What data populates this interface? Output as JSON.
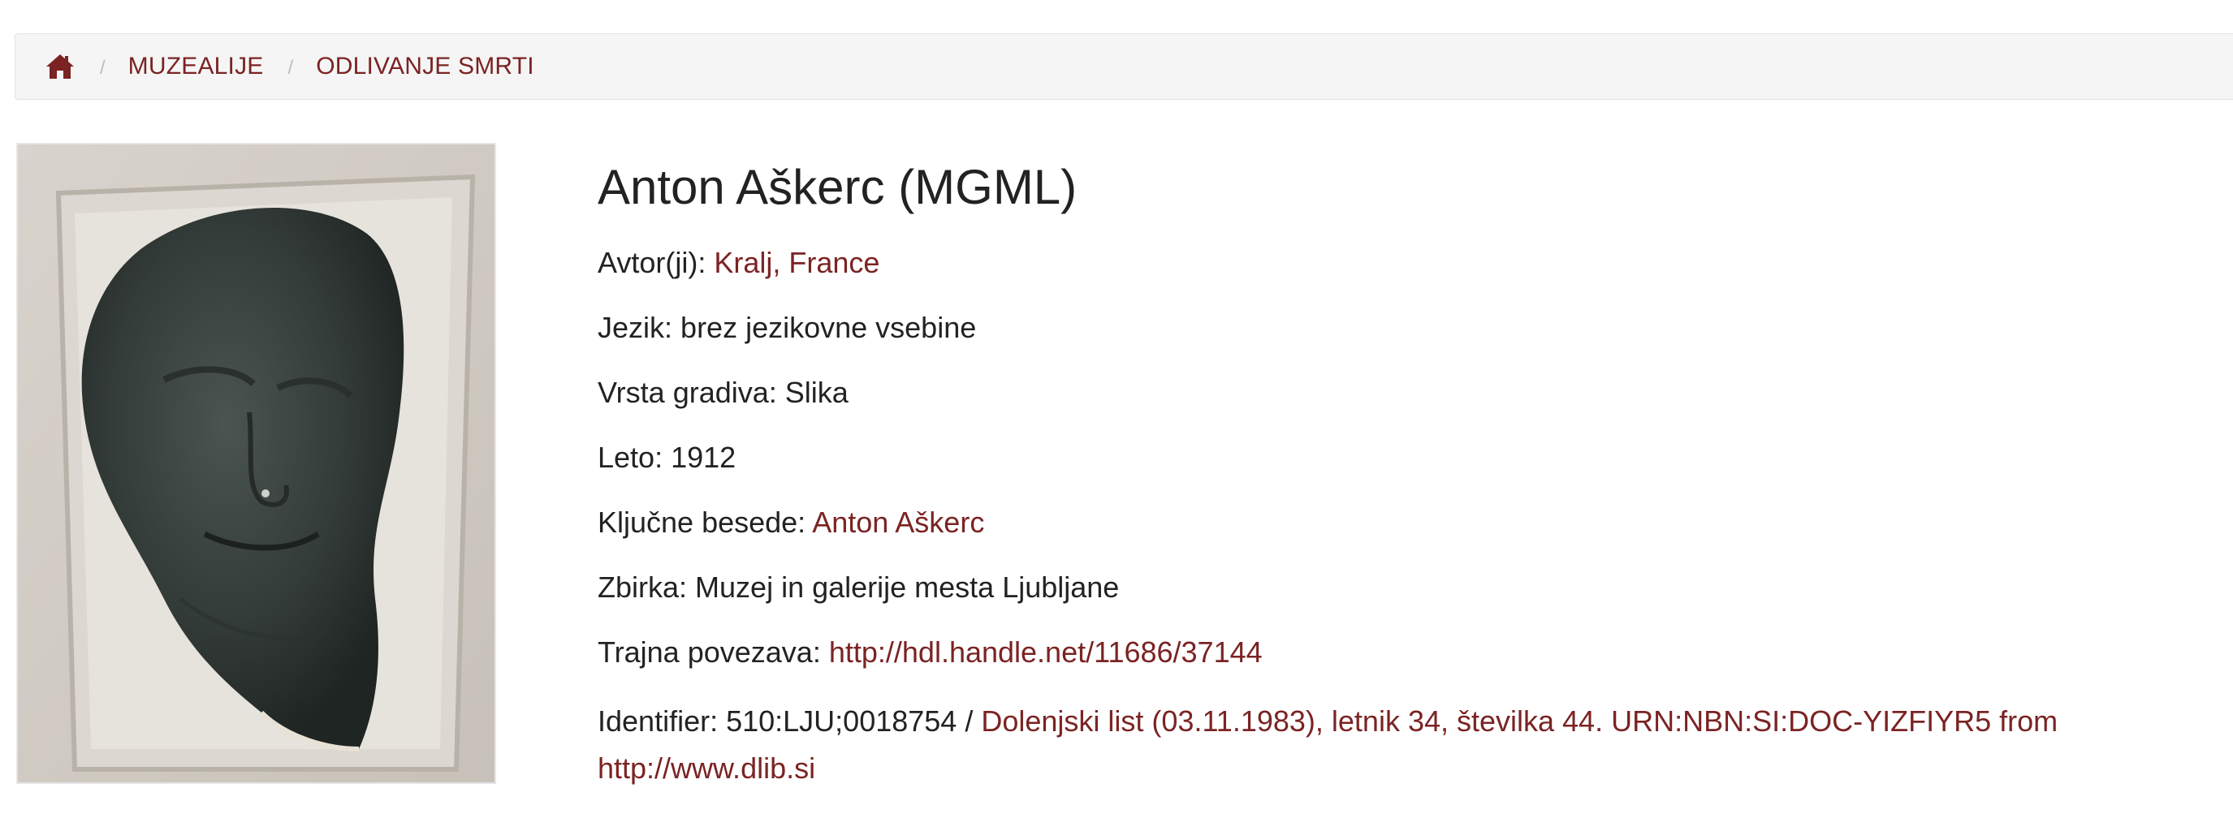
{
  "breadcrumb": {
    "home_icon": "home-icon",
    "items": [
      {
        "label": "MUZEALIJE"
      },
      {
        "label": "ODLIVANJE SMRTI"
      }
    ],
    "separator": "/"
  },
  "item": {
    "title": "Anton Aškerc (MGML)",
    "image_alt": "death mask photograph",
    "fields": {
      "author_label": "Avtor(ji):",
      "author_value": "Kralj, France",
      "language_label": "Jezik:",
      "language_value": "brez jezikovne vsebine",
      "type_label": "Vrsta gradiva:",
      "type_value": "Slika",
      "year_label": "Leto:",
      "year_value": "1912",
      "keywords_label": "Ključne besede:",
      "keywords_value": "Anton Aškerc",
      "collection_label": "Zbirka:",
      "collection_value": "Muzej in galerije mesta Ljubljane",
      "permalink_label": "Trajna povezava:",
      "permalink_value": "http://hdl.handle.net/11686/37144",
      "identifier_label": "Identifier:",
      "identifier_plain": "510:LJU;0018754 /",
      "identifier_link": "Dolenjski list (03.11.1983), letnik 34, številka 44. URN:NBN:SI:DOC-YIZFIYR5 from http://www.dlib.si"
    }
  },
  "colors": {
    "link": "#7b2323",
    "text": "#222222",
    "breadcrumb_bg": "#f5f5f5"
  }
}
